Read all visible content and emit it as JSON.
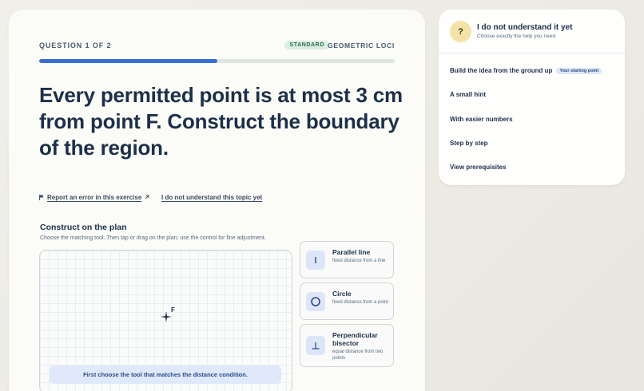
{
  "question": {
    "counter": "QUESTION 1 OF 2",
    "level_badge": "STANDARD",
    "topic": "GEOMETRIC LOCI",
    "progress_fraction": 0.5,
    "title": "Every permitted point is at most 3 cm from point F. Construct the boundary of the region.",
    "links": {
      "report_error": "Report an error in this exercise",
      "not_understand_topic": "I do not understand this topic yet"
    }
  },
  "construct": {
    "title": "Construct on the plan",
    "subtitle": "Choose the matching tool. Then tap or drag on the plan; use the control for fine adjustment.",
    "point_label": "F",
    "hint": "First choose the tool that matches the distance condition.",
    "tools": [
      {
        "title": "Parallel line",
        "desc": "fixed distance from a line",
        "icon": "parallel-line-icon"
      },
      {
        "title": "Circle",
        "desc": "fixed distance from a point",
        "icon": "circle-icon"
      },
      {
        "title": "Perpendicular bisector",
        "desc": "equal distance from two points",
        "icon": "perpendicular-icon"
      }
    ]
  },
  "help": {
    "icon": "?",
    "title": "I do not understand it yet",
    "subtitle": "Choose exactly the help you need.",
    "options": [
      {
        "label": "Build the idea from the ground up",
        "badge": "Your starting point"
      },
      {
        "label": "A small hint"
      },
      {
        "label": "With easier numbers"
      },
      {
        "label": "Step by step"
      },
      {
        "label": "View prerequisites"
      }
    ]
  },
  "colors": {
    "accent": "#3a6fd1",
    "heading": "#1d3049",
    "standard_badge_bg": "#d8efe1",
    "help_icon_bg": "#f4e3a8"
  }
}
